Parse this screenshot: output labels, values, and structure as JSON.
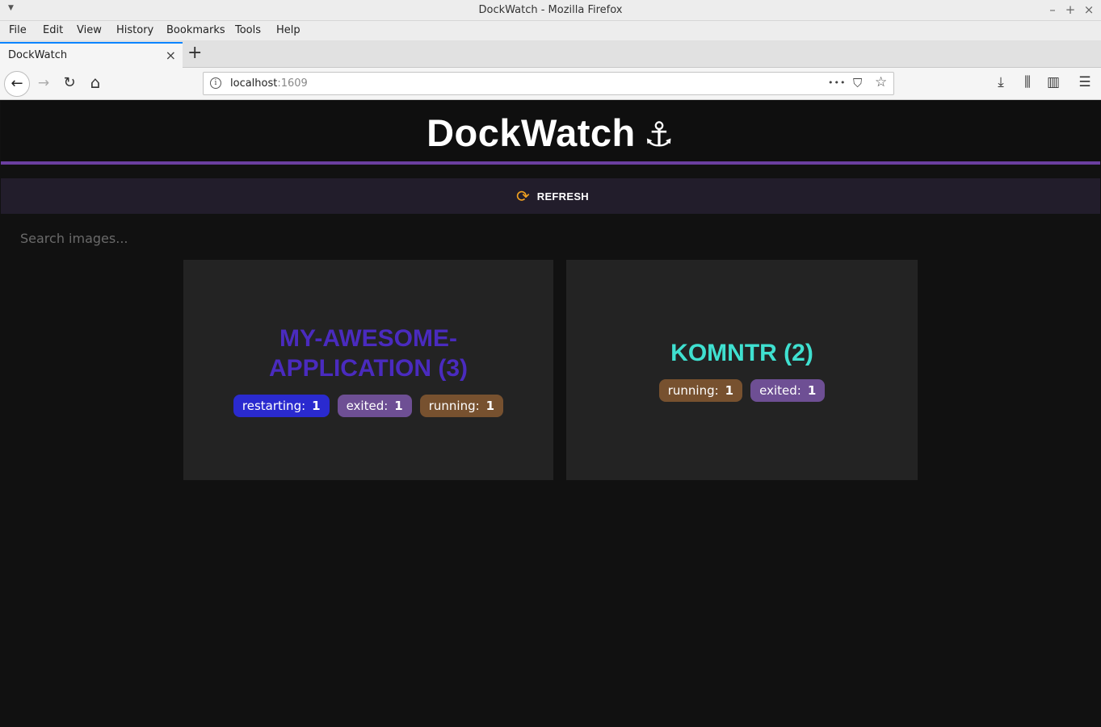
{
  "window": {
    "title": "DockWatch - Mozilla Firefox",
    "controls": {
      "minimize": "–",
      "maximize": "+",
      "close": "×"
    }
  },
  "menu": [
    "File",
    "Edit",
    "View",
    "History",
    "Bookmarks",
    "Tools",
    "Help"
  ],
  "tab": {
    "label": "DockWatch",
    "close": "×",
    "new_tab": "+"
  },
  "url": {
    "host": "localhost",
    "port": ":1609",
    "info_glyph": "i"
  },
  "nav_icons": {
    "back": "←",
    "forward": "→",
    "reload": "↻",
    "home": "⌂",
    "more": "•••",
    "pocket": "⛉",
    "bookmark": "☆",
    "downloads": "⤓",
    "library": "⫼",
    "sidebar": "▥",
    "menu": "☰"
  },
  "app": {
    "title": "DockWatch",
    "title_icon": "⚓",
    "accent_color": "#6b3fa0"
  },
  "toolbar": {
    "refresh_icon": "⟳",
    "refresh_label": "REFRESH"
  },
  "search": {
    "placeholder": "Search images...",
    "value": ""
  },
  "images": [
    {
      "name": "MY-AWESOME-APPLICATION (3)",
      "color": "#4a2bbf",
      "statuses": [
        {
          "label": "restarting:",
          "count": "1",
          "color": "#2a2acf"
        },
        {
          "label": "exited:",
          "count": "1",
          "color": "#6e4f94"
        },
        {
          "label": "running:",
          "count": "1",
          "color": "#77512f"
        }
      ]
    },
    {
      "name": "KOMNTR (2)",
      "color": "#3fe0d0",
      "statuses": [
        {
          "label": "running:",
          "count": "1",
          "color": "#77512f"
        },
        {
          "label": "exited:",
          "count": "1",
          "color": "#6e4f94"
        }
      ]
    }
  ]
}
